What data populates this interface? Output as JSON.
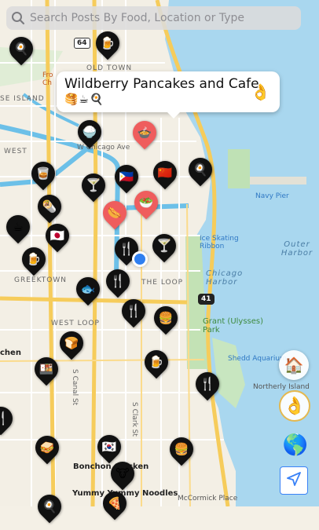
{
  "search": {
    "placeholder": "Search Posts By Food, Location or Type"
  },
  "popup": {
    "title": "Wildberry Pancakes and Cafe",
    "emojis": "🥞☕🍳",
    "rating": "👌"
  },
  "map_labels": {
    "old_town": "OLD TOWN",
    "goose_island": "SE ISLAND",
    "west": "WEST",
    "w_chicago_ave": "W Chicago Ave",
    "navy_pier": "Navy Pier",
    "ice_skating": "Ice Skating Ribbon",
    "outer_harbor": "Outer Harbor",
    "chicago_harbor": "Chicago Harbor",
    "greektown": "GREEKTOWN",
    "the_loop": "THE LOOP",
    "west_loop": "WEST LOOP",
    "grant_park": "Grant (Ulysses) Park",
    "shedd": "Shedd Aquarium",
    "northerly": "Northerly Island",
    "canal": "S Canal St",
    "clark": "S Clark St",
    "bonchon": "Bonchon Chicken",
    "chen": "chen",
    "yummy": "Yummy Yummy Noodles",
    "mccormick": "McCormick Place",
    "fro": "Fro",
    "ch": "Ch",
    "route64": "64",
    "route41": "41"
  },
  "pins": [
    {
      "g": "🍳",
      "s": "dark"
    },
    {
      "g": "🍺",
      "s": "dark"
    },
    {
      "g": "🍚",
      "s": "dark"
    },
    {
      "g": "🍲",
      "s": "red"
    },
    {
      "g": "🥃",
      "s": "dark"
    },
    {
      "g": "🍸",
      "s": "dark"
    },
    {
      "g": "🇵🇭",
      "s": "dark"
    },
    {
      "g": "🇨🇳",
      "s": "dark"
    },
    {
      "g": "🍳",
      "s": "dark"
    },
    {
      "g": "🥗",
      "s": "red"
    },
    {
      "g": "🌭",
      "s": "red"
    },
    {
      "g": "🌯",
      "s": "dark"
    },
    {
      "g": "☕",
      "s": "dark"
    },
    {
      "g": "🇯🇵",
      "s": "dark"
    },
    {
      "g": "🍴",
      "s": "dark"
    },
    {
      "g": "🍸",
      "s": "dark"
    },
    {
      "g": "🍺",
      "s": "dark"
    },
    {
      "g": "🍴",
      "s": "dark"
    },
    {
      "g": "🐟",
      "s": "dark"
    },
    {
      "g": "🍴",
      "s": "dark"
    },
    {
      "g": "🍔",
      "s": "dark"
    },
    {
      "g": "🍞",
      "s": "dark"
    },
    {
      "g": "🍺",
      "s": "dark"
    },
    {
      "g": "🍴",
      "s": "dark"
    },
    {
      "g": "🍱",
      "s": "dark"
    },
    {
      "g": "🥪",
      "s": "dark"
    },
    {
      "g": "🇰🇷",
      "s": "dark"
    },
    {
      "g": "🍔",
      "s": "dark"
    },
    {
      "g": "🐮",
      "s": "dark"
    },
    {
      "g": "🍕",
      "s": "dark"
    },
    {
      "g": "🍴",
      "s": "dark"
    },
    {
      "g": "🍳",
      "s": "dark"
    }
  ],
  "controls": {
    "home": "🏠",
    "ok": "👌",
    "globe": "🌎"
  }
}
